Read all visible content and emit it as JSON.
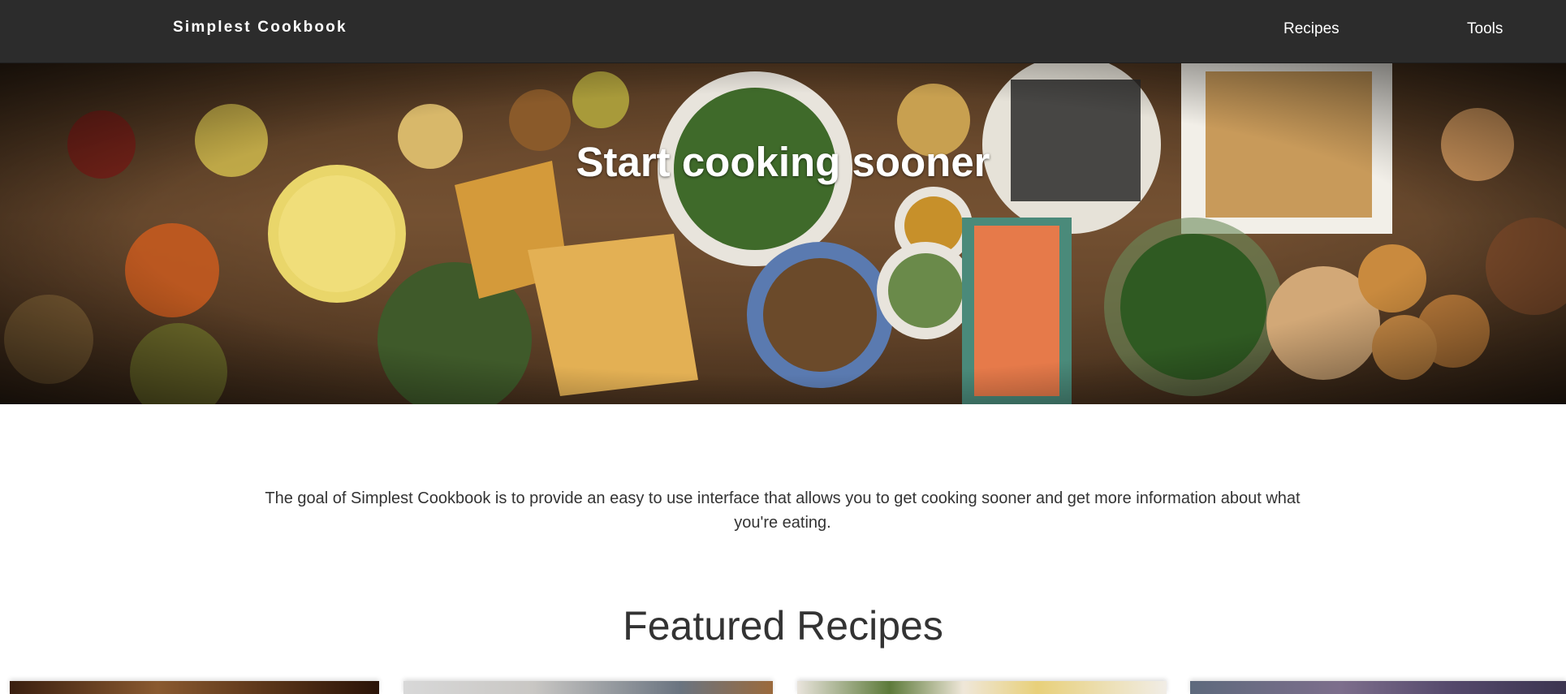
{
  "navbar": {
    "brand": "Simplest Cookbook",
    "links": [
      {
        "label": "Recipes"
      },
      {
        "label": "Tools"
      }
    ],
    "background_color": "#2c2c2c"
  },
  "hero": {
    "title": "Start cooking sooner"
  },
  "intro": {
    "text": "The goal of Simplest Cookbook is to provide an easy to use interface that allows you to get cooking sooner and get more information about what you're eating."
  },
  "featured": {
    "heading": "Featured Recipes"
  }
}
